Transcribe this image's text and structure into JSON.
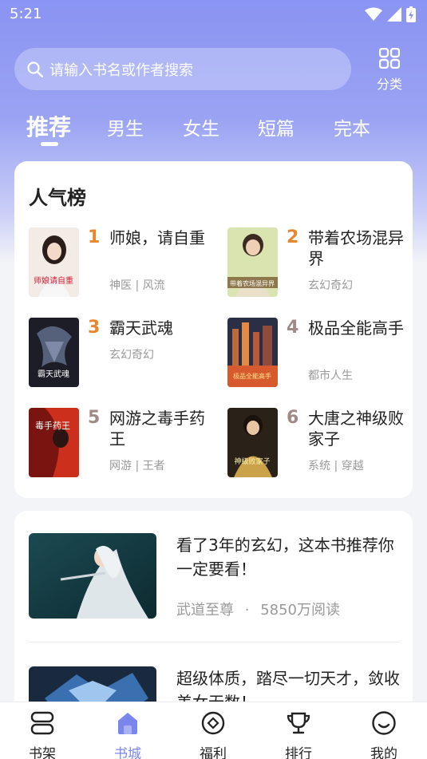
{
  "status": {
    "time": "5:21"
  },
  "search": {
    "placeholder": "请输入书名或作者搜索"
  },
  "category": {
    "label": "分类"
  },
  "tabs": [
    {
      "label": "推荐",
      "active": true
    },
    {
      "label": "男生"
    },
    {
      "label": "女生"
    },
    {
      "label": "短篇"
    },
    {
      "label": "完本"
    }
  ],
  "ranking": {
    "title": "人气榜",
    "items": [
      {
        "rank": "1",
        "name": "师娘，请自重",
        "tags": "神医 | 风流",
        "cover_text": "师娘请自重"
      },
      {
        "rank": "2",
        "name": "带着农场混异界",
        "tags": "玄幻奇幻",
        "cover_text": "带着农场混异界"
      },
      {
        "rank": "3",
        "name": "霸天武魂",
        "tags": "玄幻奇幻",
        "cover_text": "霸天武魂"
      },
      {
        "rank": "4",
        "name": "极品全能高手",
        "tags": "都市人生",
        "cover_text": "极品全能高手"
      },
      {
        "rank": "5",
        "name": "网游之毒手药王",
        "tags": "网游 | 王者",
        "cover_text": "毒手药王"
      },
      {
        "rank": "6",
        "name": "大唐之神级败家子",
        "tags": "系统 | 穿越",
        "cover_text": "神级败家子"
      }
    ]
  },
  "feed": [
    {
      "title": "看了3年的玄幻，这本书推荐你一定要看！",
      "book": "武道至尊",
      "dot": "·",
      "reads": "5850万阅读"
    },
    {
      "title": "超级体质，踏尽一切天才，敛收美女无数！",
      "book": "",
      "dot": "",
      "reads": ""
    }
  ],
  "nav": [
    {
      "label": "书架",
      "icon": "bookshelf-icon"
    },
    {
      "label": "书城",
      "icon": "bookstore-icon",
      "active": true
    },
    {
      "label": "福利",
      "icon": "welfare-icon"
    },
    {
      "label": "排行",
      "icon": "trophy-icon"
    },
    {
      "label": "我的",
      "icon": "profile-icon"
    }
  ],
  "colors": {
    "accent": "#7a86ee",
    "rank_top": "#e8862e",
    "rank_other": "#a08a86"
  }
}
